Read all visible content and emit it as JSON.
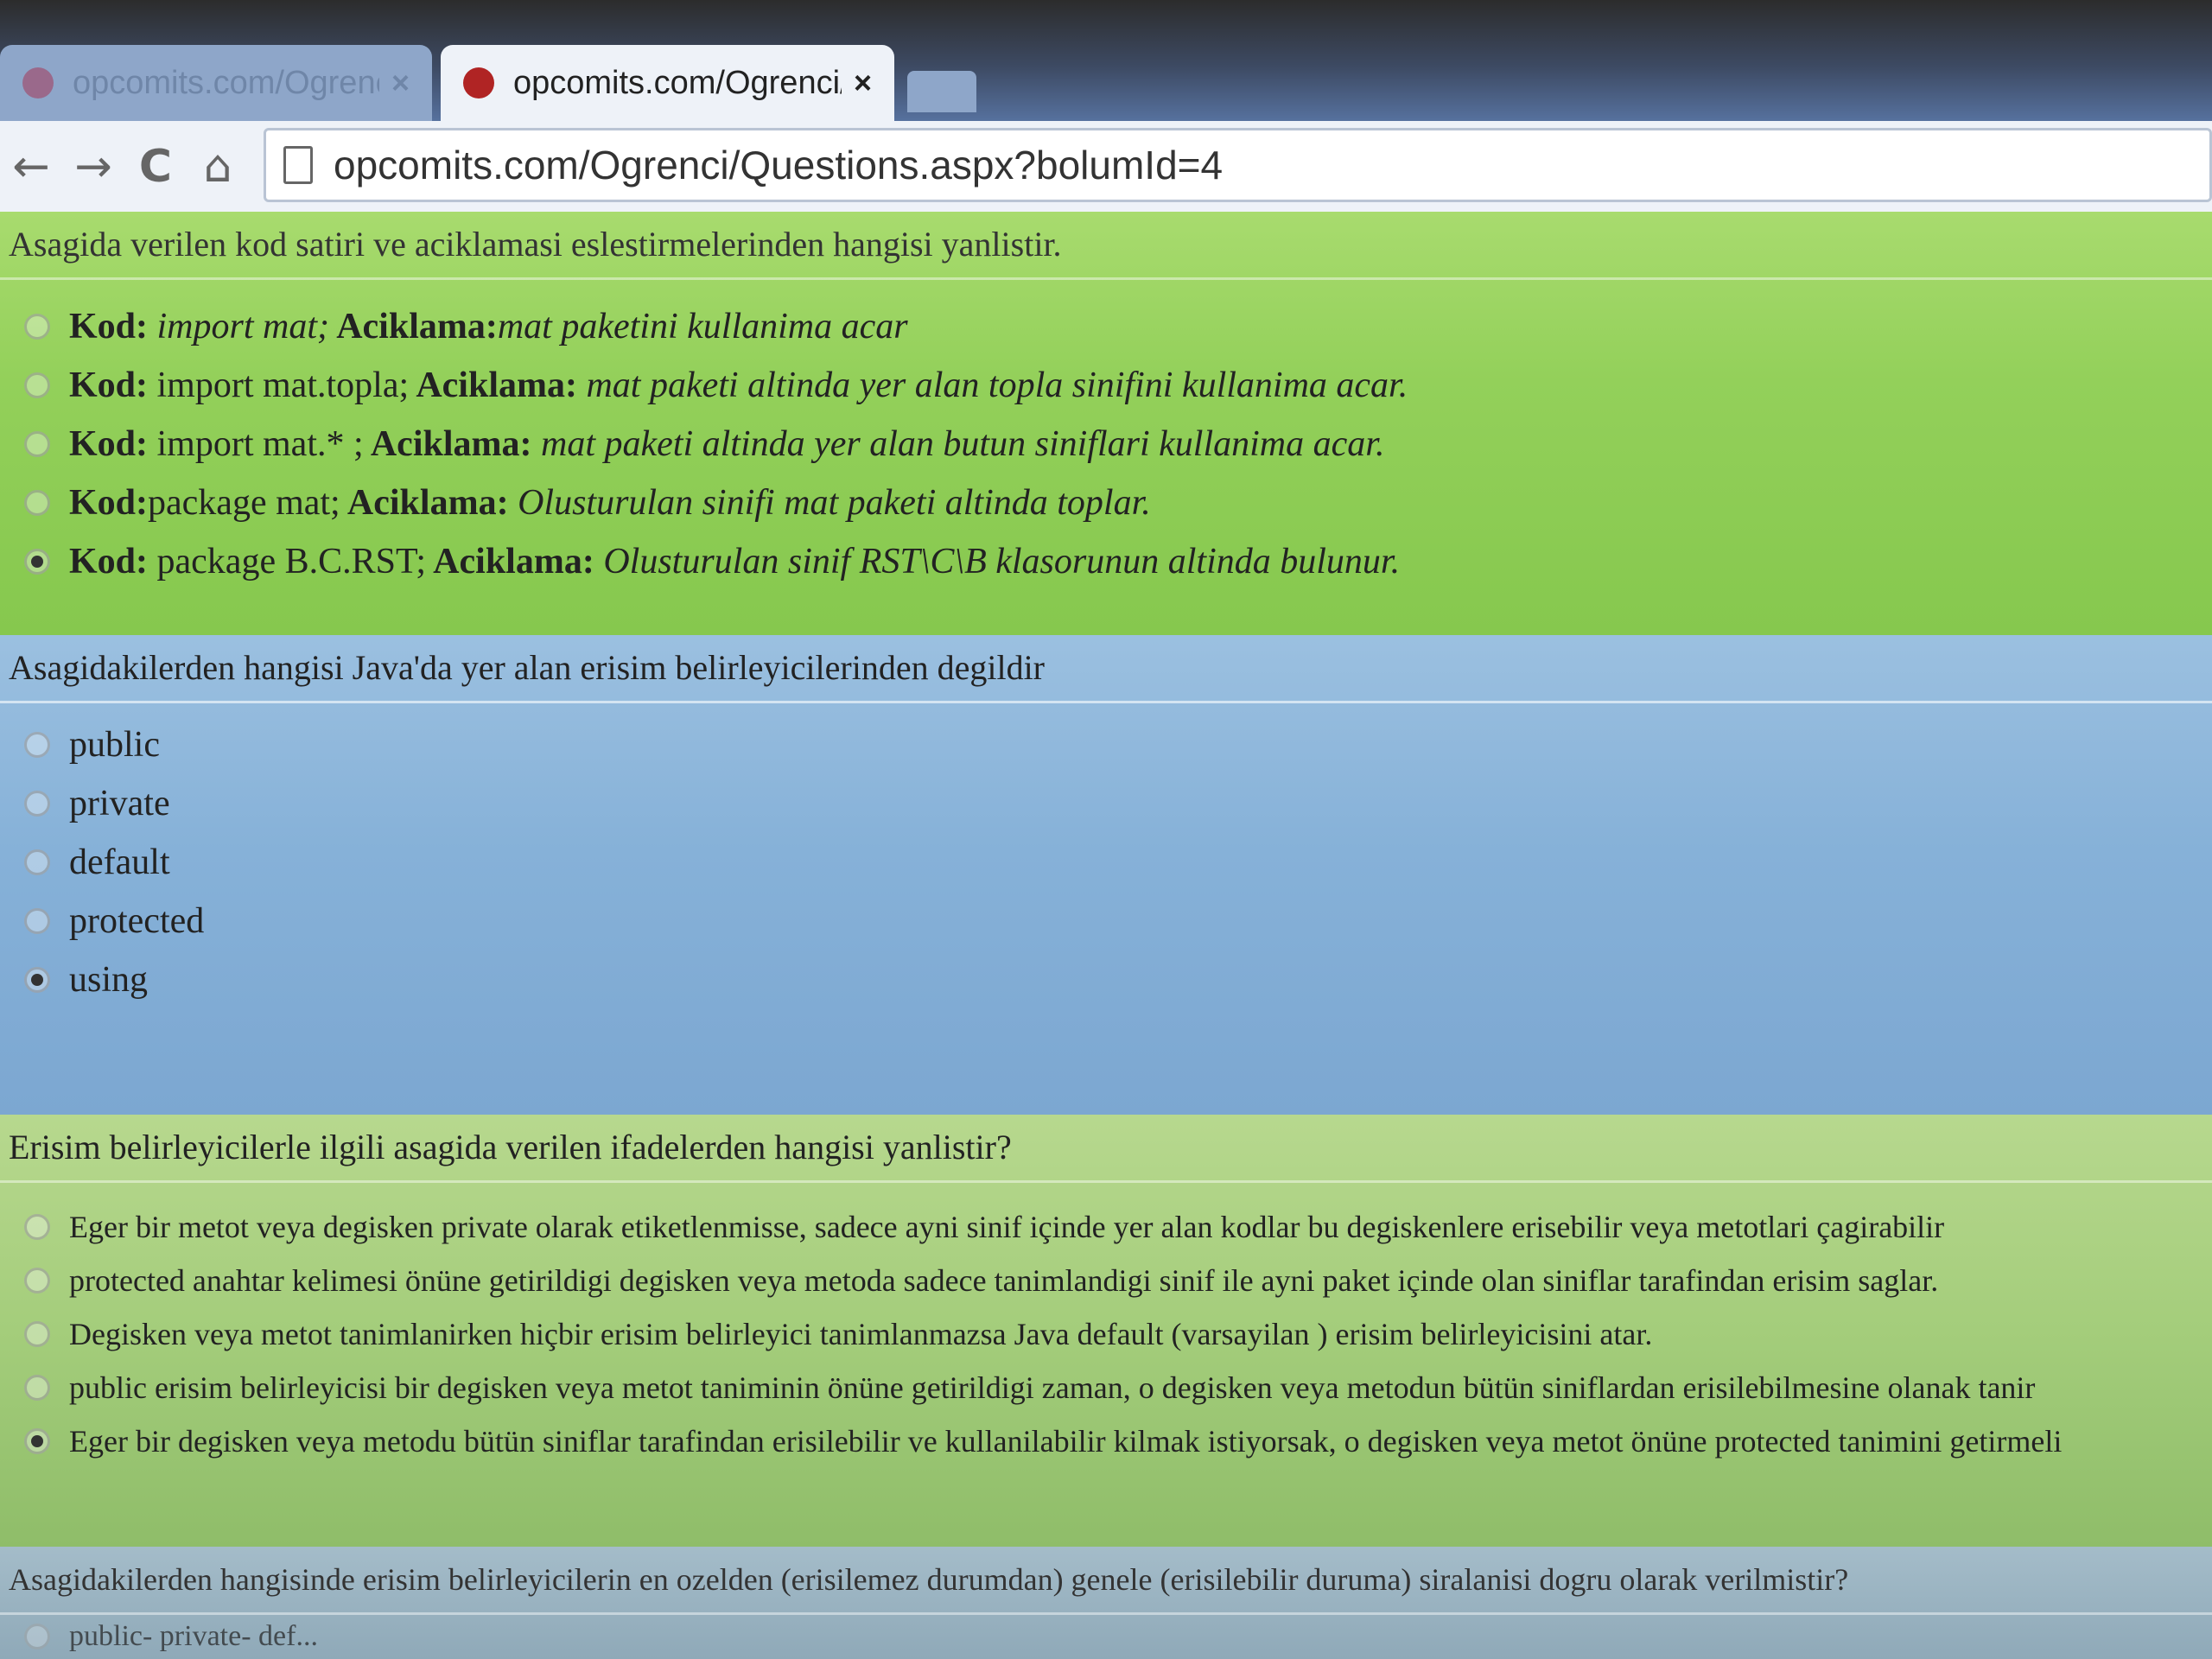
{
  "browser": {
    "tabs": [
      {
        "title": "opcomits.com/Ogrenci/C",
        "close": "×",
        "active": false
      },
      {
        "title": "opcomits.com/Ogrenci/C",
        "close": "×",
        "active": true
      }
    ],
    "nav": {
      "back": "←",
      "forward": "→",
      "reload": "C",
      "home": "⌂"
    },
    "url": "opcomits.com/Ogrenci/Questions.aspx?bolumId=4"
  },
  "questions": [
    {
      "text": "Asagida verilen kod satiri ve aciklamasi eslestirmelerinden hangisi yanlistir.",
      "options": [
        {
          "kod_label": "Kod:",
          "kod": " import mat;",
          "ack_label": " Aciklama:",
          "ack": "mat paketini kullanima acar",
          "selected": false
        },
        {
          "kod_label": "Kod:",
          "kod": " import mat.topla;",
          "ack_label": " Aciklama:",
          "ack": " mat paketi altinda yer alan topla sinifini kullanima acar.",
          "selected": false
        },
        {
          "kod_label": "Kod:",
          "kod": " import mat.* ;",
          "ack_label": " Aciklama:",
          "ack": " mat paketi altinda yer alan butun siniflari kullanima acar.",
          "selected": false
        },
        {
          "kod_label": "Kod:",
          "kod": "package mat;",
          "ack_label": " Aciklama:",
          "ack": " Olusturulan sinifi mat paketi altinda toplar.",
          "selected": false
        },
        {
          "kod_label": "Kod:",
          "kod": " package B.C.RST;",
          "ack_label": " Aciklama:",
          "ack": " Olusturulan sinif RST\\C\\B klasorunun altinda bulunur.",
          "selected": true
        }
      ]
    },
    {
      "text": "Asagidakilerden hangisi Java'da yer alan erisim belirleyicilerinden degildir",
      "options": [
        {
          "label": "public",
          "selected": false
        },
        {
          "label": "private",
          "selected": false
        },
        {
          "label": "default",
          "selected": false
        },
        {
          "label": "protected",
          "selected": false
        },
        {
          "label": "using",
          "selected": true
        }
      ]
    },
    {
      "text": "Erisim belirleyicilerle ilgili asagida verilen ifadelerden hangisi yanlistir?",
      "options": [
        {
          "label": "Eger bir metot veya degisken private olarak etiketlenmisse, sadece ayni sinif içinde yer alan kodlar bu degiskenlere erisebilir veya metotlari çagirabilir",
          "selected": false
        },
        {
          "label": "protected anahtar kelimesi önüne getirildigi degisken veya metoda sadece tanimlandigi sinif ile ayni paket içinde olan siniflar tarafindan erisim saglar.",
          "selected": false
        },
        {
          "label": "Degisken veya metot tanimlanirken hiçbir erisim belirleyici tanimlanmazsa Java default (varsayilan ) erisim belirleyicisini atar.",
          "selected": false
        },
        {
          "label": "public erisim belirleyicisi bir degisken veya metot taniminin önüne getirildigi zaman, o degisken veya metodun bütün siniflardan erisilebilmesine olanak tanir",
          "selected": false
        },
        {
          "label": "Eger bir degisken veya metodu bütün siniflar tarafindan erisilebilir ve kullanilabilir kilmak istiyorsak, o degisken veya metot önüne protected tanimini getirmeli",
          "selected": true
        }
      ]
    },
    {
      "text": "Asagidakilerden hangisinde erisim belirleyicilerin en ozelden (erisilemez durumdan) genele (erisilebilir duruma) siralanisi dogru olarak verilmistir?",
      "options": [
        {
          "label": "public- private- def...",
          "selected": false
        }
      ]
    }
  ]
}
